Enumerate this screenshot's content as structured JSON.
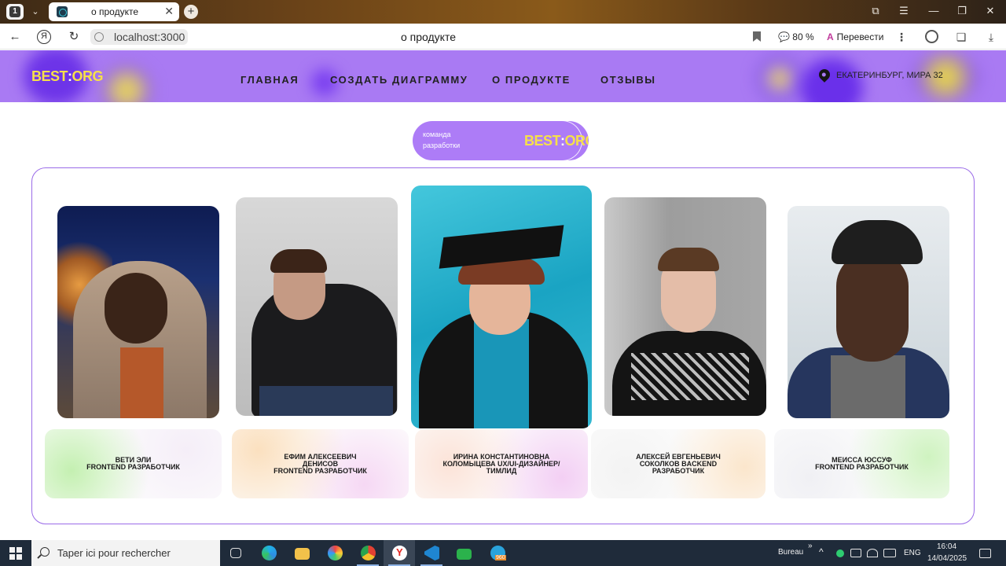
{
  "browser": {
    "tab_count_badge": "1",
    "tab_title": "о продукте",
    "tab_close": "✕",
    "new_tab": "+",
    "url": "localhost:3000",
    "page_title": "о продукте",
    "zoom": "80 %",
    "translate_label": "Перевести",
    "back_icon": "←",
    "yandex_icon": "Я",
    "reload_icon": "↻",
    "menu_icon": "⋮"
  },
  "site": {
    "logo_main": "BEST",
    "logo_sep": ":",
    "logo_tail": "ORG",
    "nav": [
      {
        "label": "ГЛАВНАЯ"
      },
      {
        "label": "СОЗДАТЬ ДИАГРАММУ"
      },
      {
        "label": "О ПРОДУКТЕ"
      },
      {
        "label": "ОТЗЫВЫ"
      }
    ],
    "address": "ЕКАТЕРИНБУРГ, МИРА 32",
    "accent_color": "#a97af3",
    "logo_color": "#f6e04a"
  },
  "team_badge": {
    "line1": "команда",
    "line2": "разработки",
    "logo_main": "BEST",
    "logo_sep": ":",
    "logo_tail": "ORG"
  },
  "team": [
    {
      "line1": "ВЕТИ ЭЛИ",
      "line2": "FRONTEND РАЗРАБОТЧИК",
      "line3": ""
    },
    {
      "line1": "ЕФИМ АЛЕКСЕЕВИЧ",
      "line2": "ДЕНИСОВ",
      "line3": "FRONTEND РАЗРАБОТЧИК"
    },
    {
      "line1": "ИРИНА КОНСТАНТИНОВНА",
      "line2": "КОЛОМЫЦЕВА UX/UI-ДИЗАЙНЕР/",
      "line3": "ТИМЛИД"
    },
    {
      "line1": "АЛЕКСЕЙ ЕВГЕНЬЕВИЧ",
      "line2": "СОКОЛКОВ BACKEND",
      "line3": "РАЗРАБОТЧИК"
    },
    {
      "line1": "МЕИССА ЮССУФ",
      "line2": "FRONTEND РАЗРАБОТЧИК",
      "line3": ""
    }
  ],
  "taskbar": {
    "search_placeholder": "Taper ici pour rechercher",
    "bureau": "Bureau",
    "lang": "ENG",
    "time": "16:04",
    "date": "14/04/2025",
    "telegram_badge": "960"
  }
}
